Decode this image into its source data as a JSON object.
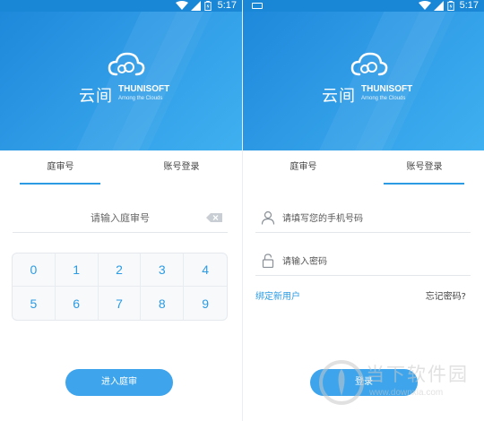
{
  "status_bar": {
    "time": "5:17"
  },
  "brand": {
    "name_zh": "云间",
    "name_en": "THUNISOFT",
    "tagline": "Among the Clouds"
  },
  "tabs": [
    {
      "label": "庭审号"
    },
    {
      "label": "账号登录"
    }
  ],
  "court_panel": {
    "active_tab": 0,
    "input_placeholder": "请输入庭审号",
    "input_value": "",
    "keys": [
      "0",
      "1",
      "2",
      "3",
      "4",
      "5",
      "6",
      "7",
      "8",
      "9"
    ],
    "enter_button": "进入庭审"
  },
  "login_panel": {
    "active_tab": 1,
    "phone_placeholder": "请填写您的手机号码",
    "password_placeholder": "请输入密码",
    "bind_link": "绑定新用户",
    "forgot_link": "忘记密码?",
    "login_button": "登录"
  },
  "watermark": {
    "title": "当下软件园",
    "url": "www.downxia.com"
  },
  "colors": {
    "accent": "#2c9be3",
    "header_start": "#1e88da",
    "header_end": "#3fb0f0",
    "button": "#3ea5ec"
  },
  "icons": [
    "wifi-icon",
    "signal-icon",
    "battery-icon",
    "cloud-logo-icon",
    "backspace-icon",
    "user-icon",
    "lock-icon"
  ]
}
